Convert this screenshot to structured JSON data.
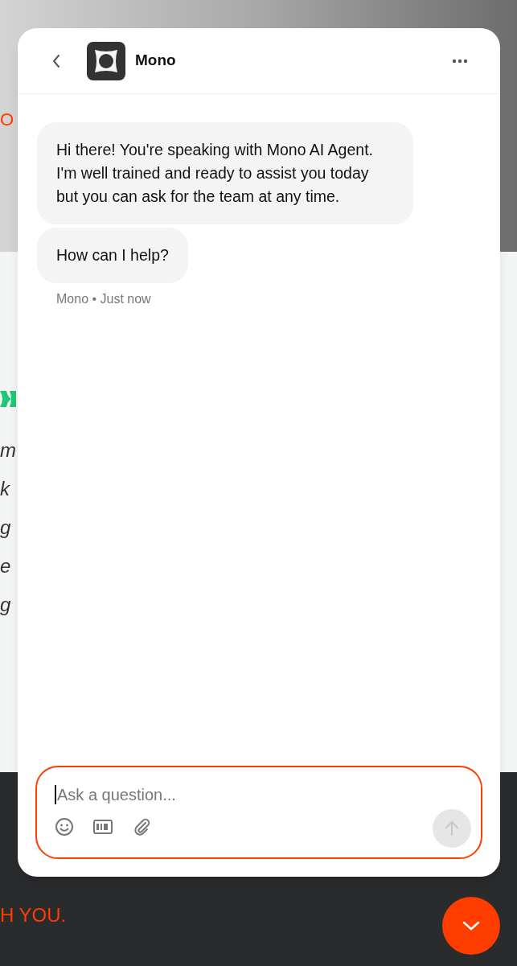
{
  "background": {
    "accent_letter": "O",
    "italic_fragments": [
      "m",
      "k",
      "g",
      "e",
      "g"
    ],
    "footer_tagline": "H YOU."
  },
  "chat": {
    "title": "Mono",
    "messages": [
      {
        "text": "Hi there! You're speaking with Mono AI Agent. I'm well trained and ready to assist you today but you can ask for the team at any time."
      },
      {
        "text": "How can I help?"
      }
    ],
    "meta": "Mono • Just now",
    "composer": {
      "placeholder": "Ask a question...",
      "send_disabled": true
    }
  }
}
